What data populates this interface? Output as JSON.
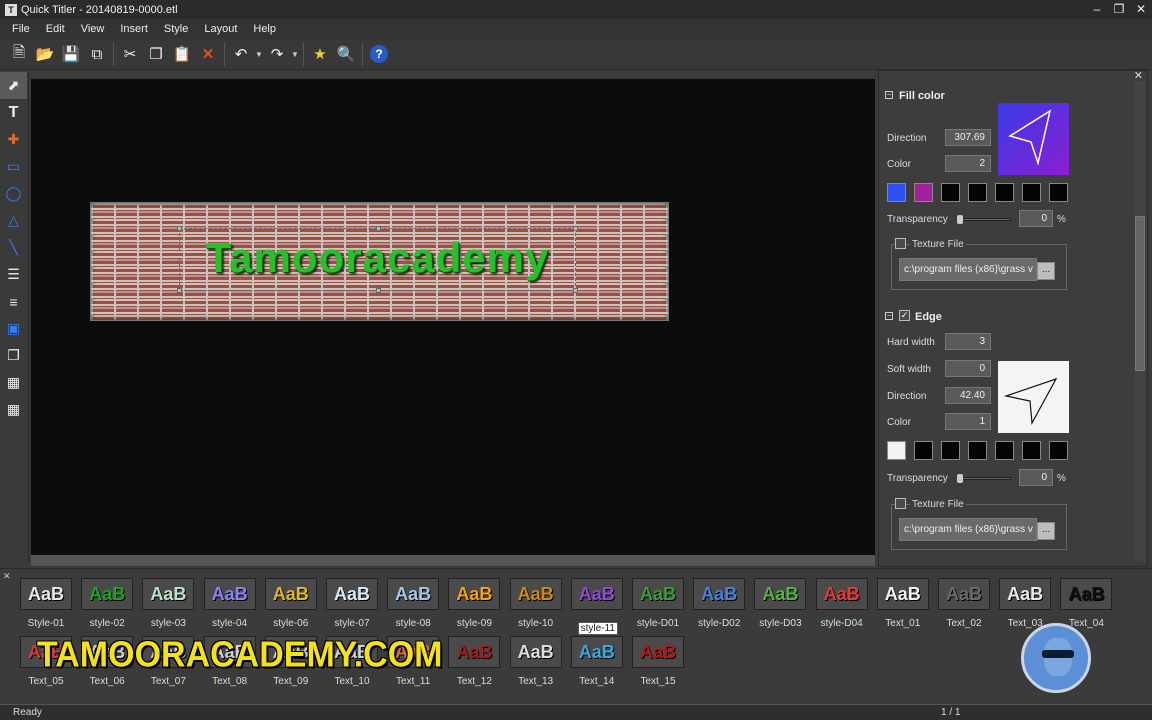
{
  "window": {
    "title": "Quick Titler - 20140819-0000.etl",
    "app_icon": "T"
  },
  "menu": [
    "File",
    "Edit",
    "View",
    "Insert",
    "Style",
    "Layout",
    "Help"
  ],
  "canvas": {
    "text": "Tamooracademy"
  },
  "panel": {
    "fill": {
      "header": "Fill color",
      "direction_label": "Direction",
      "direction_value": "307.69",
      "color_label": "Color",
      "color_value": "2",
      "transparency_label": "Transparency",
      "transparency_value": "0",
      "transparency_unit": "%",
      "swatches": [
        "#2e4ff2",
        "#a1219b",
        "#050505",
        "#050505",
        "#050505",
        "#050505",
        "#050505"
      ],
      "texture_label": "Texture File",
      "texture_path": "c:\\program files (x86)\\grass v",
      "browse_label": "...",
      "gradient_from": "#3a3ae8",
      "gradient_to": "#8a1fd0"
    },
    "edge": {
      "header": "Edge",
      "hard_width_label": "Hard width",
      "hard_width_value": "3",
      "soft_width_label": "Soft width",
      "soft_width_value": "0",
      "direction_label": "Direction",
      "direction_value": "42.40",
      "color_label": "Color",
      "color_value": "1",
      "transparency_label": "Transparency",
      "transparency_value": "0",
      "transparency_unit": "%",
      "swatches": [
        "#f2f2f2",
        "#050505",
        "#050505",
        "#050505",
        "#050505",
        "#050505",
        "#050505"
      ],
      "texture_label": "Texture File",
      "texture_path": "c:\\program files (x86)\\grass v",
      "browse_label": "..."
    }
  },
  "styles": [
    {
      "label": "Style-01",
      "text": "AaB",
      "color": "#e8e8e8"
    },
    {
      "label": "style-02",
      "text": "AaB",
      "color": "#1fa32a"
    },
    {
      "label": "style-03",
      "text": "AaB",
      "color": "#bfe0c8"
    },
    {
      "label": "style-04",
      "text": "AaB",
      "color": "#8a83f0"
    },
    {
      "label": "style-06",
      "text": "AaB",
      "color": "#e0b630"
    },
    {
      "label": "style-07",
      "text": "AaB",
      "color": "#d8e8f4"
    },
    {
      "label": "style-08",
      "text": "AaB",
      "color": "#a9c5e6"
    },
    {
      "label": "style-09",
      "text": "AaB",
      "color": "#f0a01a"
    },
    {
      "label": "style-10",
      "text": "AaB",
      "color": "#c88a1a"
    },
    {
      "label": "style-11",
      "text": "AaB",
      "color": "#8e4ad0"
    },
    {
      "label": "style-D01",
      "text": "AaB",
      "color": "#3c9a3a"
    },
    {
      "label": "style-D02",
      "text": "AaB",
      "color": "#4a7fd8"
    },
    {
      "label": "style-D03",
      "text": "AaB",
      "color": "#55b045"
    },
    {
      "label": "style-D04",
      "text": "AaB",
      "color": "#e03b3b"
    },
    {
      "label": "Text_01",
      "text": "AaB",
      "color": "#f2f2f2"
    },
    {
      "label": "Text_02",
      "text": "AaB",
      "color": "#6a6a6a"
    },
    {
      "label": "Text_03",
      "text": "AaB",
      "color": "#e8e8e8"
    },
    {
      "label": "Text_04",
      "text": "AaB",
      "color": "#111111"
    },
    {
      "label": "Text_05",
      "text": "AaB",
      "color": "#d83a3a"
    },
    {
      "label": "Text_06",
      "text": "AaB",
      "color": "#d0d0d0"
    },
    {
      "label": "Text_07",
      "text": "AaB",
      "color": "#d0d0d0"
    },
    {
      "label": "Text_08",
      "text": "AaB",
      "color": "#d0d0d0"
    },
    {
      "label": "Text_09",
      "text": "AaB",
      "color": "#d0d0d0"
    },
    {
      "label": "Text_10",
      "text": "AaB",
      "color": "#d0d0d0"
    },
    {
      "label": "Text_11",
      "text": "AaB",
      "color": "#d86a3a"
    },
    {
      "label": "Text_12",
      "text": "AaB",
      "color": "#9a1f1f"
    },
    {
      "label": "Text_13",
      "text": "AaB",
      "color": "#dcdcdc"
    },
    {
      "label": "Text_14",
      "text": "AaB",
      "color": "#3aa8e0"
    },
    {
      "label": "Text_15",
      "text": "AaB",
      "color": "#b01a1a"
    }
  ],
  "watermark": "TAMOORACADEMY.COM",
  "status": {
    "left": "Ready",
    "right": "1 / 1"
  }
}
